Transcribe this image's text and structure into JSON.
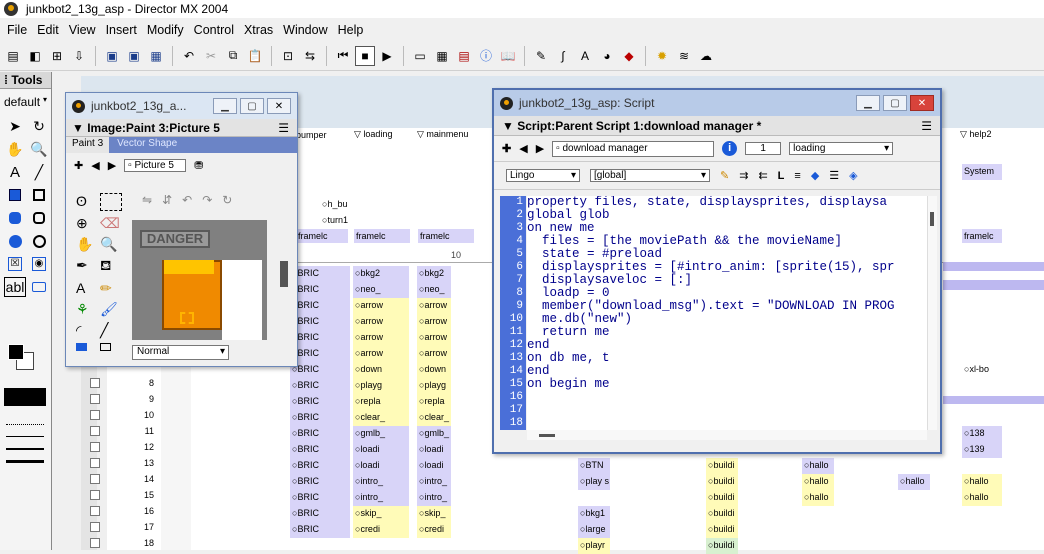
{
  "app": {
    "title": "junkbot2_13g_asp - Director MX 2004"
  },
  "menu": [
    "File",
    "Edit",
    "View",
    "Insert",
    "Modify",
    "Control",
    "Xtras",
    "Window",
    "Help"
  ],
  "tools": {
    "title": "Tools",
    "mode": "default"
  },
  "score": {
    "channels": [
      "bumper",
      "loading",
      "mainmenu",
      "help2"
    ],
    "frame_marker": "10",
    "row_numbers": [
      "8",
      "9",
      "10",
      "11",
      "12",
      "13",
      "14",
      "15",
      "16",
      "17",
      "18"
    ],
    "col1": [
      "h_bu",
      "turn1",
      "framelc"
    ],
    "col_a": [
      "BRIC",
      "BRIC",
      "BRIC",
      "BRIC",
      "BRIC",
      "BRIC",
      "BRIC",
      "BRIC",
      "BRIC",
      "BRIC",
      "BRIC",
      "BRIC",
      "BRIC",
      "BRIC",
      "BRIC",
      "BRIC",
      "BRIC",
      "BRIC"
    ],
    "col_b": [
      "bkg2",
      "neo_",
      "arrow",
      "arrow",
      "arrow",
      "arrow",
      "down",
      "playg",
      "repla",
      "clear_",
      "gmlb_",
      "loadi",
      "loadi",
      "intro_",
      "intro_",
      "skip_",
      "credi"
    ],
    "col_c": [
      "bkg2",
      "neo_",
      "arrow",
      "arrow",
      "arrow",
      "arrow",
      "down",
      "playg",
      "repla",
      "clear_",
      "gmlb_",
      "loadi",
      "loadi",
      "intro_",
      "intro_",
      "skip_",
      "credi"
    ],
    "col_d": [
      "BTN",
      "play s",
      "",
      "bkg1",
      "large",
      "playr"
    ],
    "col_e": [
      "buildi",
      "buildi",
      "buildi",
      "buildi",
      "buildi",
      "buildi"
    ],
    "col_f": [
      "hallo",
      "hallo",
      "hallo"
    ],
    "col_g": [
      "hallo"
    ],
    "col_h": [
      "System",
      "framelc",
      "xl-bo",
      "138",
      "139",
      "hallo",
      "hallo"
    ]
  },
  "paint": {
    "title": "junkbot2_13g_a...",
    "header": "Image:Paint 3:Picture 5",
    "tab1": "Paint 3",
    "tab2": "Vector Shape",
    "member": "Picture 5",
    "ink": "Normal",
    "sign": "DANGER"
  },
  "script": {
    "title": "junkbot2_13g_asp: Script",
    "header": "Script:Parent Script 1:download manager *",
    "member_name": "download manager",
    "cast_num": "1",
    "cast_lib": "loading",
    "language": "Lingo",
    "scope": "[global]",
    "lines": [
      "property files, state, displaysprites, displaysa",
      "global glob",
      "",
      "on new me",
      "  files = [the moviePath && the movieName]",
      "  state = #preload",
      "  displaysprites = [#intro_anim: [sprite(15), spr",
      "  displaysaveloc = [:]",
      "  loadp = 0",
      "  member(\"download_msg\").text = \"DOWNLOAD IN PROG",
      "  me.db(\"new\")",
      "  return me",
      "end",
      "",
      "on db me, t",
      "end",
      "",
      "on begin me"
    ],
    "line_numbers": [
      "1",
      "2",
      "3",
      "4",
      "5",
      "6",
      "7",
      "8",
      "9",
      "10",
      "11",
      "12",
      "13",
      "14",
      "15",
      "16",
      "17",
      "18"
    ]
  },
  "colors": {
    "violet": "#d8d4f8",
    "yellow": "#fffbb8",
    "line_gutter": "#4a6fd8",
    "title_active": "#dbe6f3"
  }
}
